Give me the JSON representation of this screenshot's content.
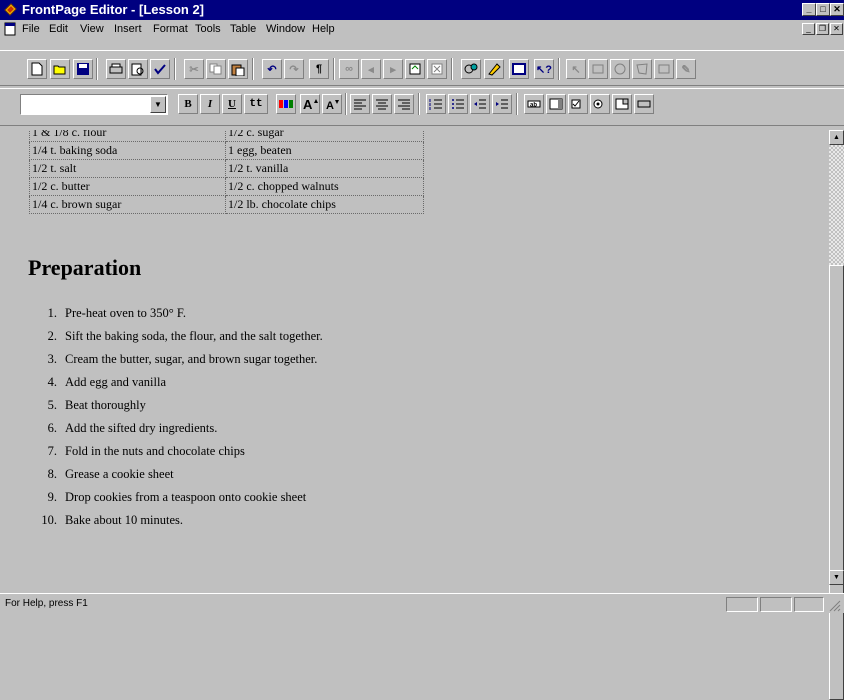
{
  "window": {
    "title": "FrontPage Editor - [Lesson 2]"
  },
  "menu": [
    "File",
    "Edit",
    "View",
    "Insert",
    "Format",
    "Tools",
    "Table",
    "Window",
    "Help"
  ],
  "format_toolbar": {
    "bold": "B",
    "italic": "I",
    "underline": "U",
    "typewriter": "tt"
  },
  "ingredients_table": [
    [
      "1 & 1/8 c. flour",
      "1/2 c. sugar"
    ],
    [
      "1/4 t. baking soda",
      "1 egg, beaten"
    ],
    [
      "1/2 t. salt",
      "1/2 t. vanilla"
    ],
    [
      "1/2 c. butter",
      "1/2 c. chopped walnuts"
    ],
    [
      "1/4 c. brown sugar",
      "1/2 lb. chocolate chips"
    ]
  ],
  "document": {
    "heading": "Preparation",
    "steps": [
      {
        "num": "1.",
        "text": "Pre-heat oven to 350° F."
      },
      {
        "num": "2.",
        "text": "Sift the baking soda, the flour, and the salt together."
      },
      {
        "num": "3.",
        "text": "Cream the butter, sugar, and brown sugar together."
      },
      {
        "num": "4.",
        "text": "Add egg and vanilla"
      },
      {
        "num": "5.",
        "text": "Beat thoroughly"
      },
      {
        "num": "6.",
        "text": "Add the sifted dry ingredients."
      },
      {
        "num": "7.",
        "text": "Fold in the nuts and chocolate chips"
      },
      {
        "num": "8.",
        "text": "Grease a cookie sheet"
      },
      {
        "num": "9.",
        "text": "Drop cookies from a teaspoon onto cookie sheet"
      },
      {
        "num": "10.",
        "text": "Bake about 10 minutes."
      }
    ]
  },
  "status": {
    "message": "For Help, press F1"
  }
}
